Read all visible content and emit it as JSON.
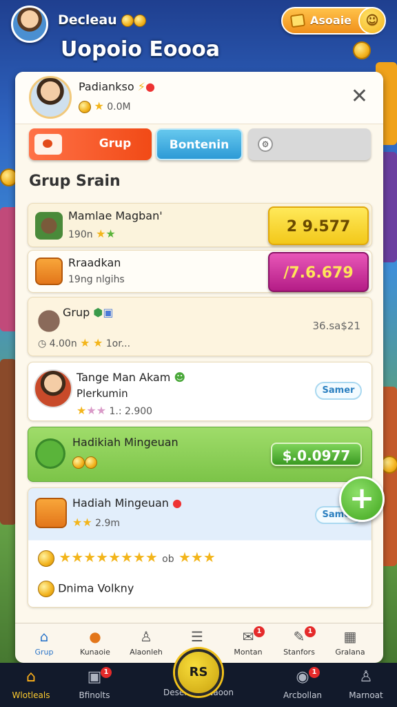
{
  "topbar": {
    "username": "Decleau",
    "title": "Uopoio Eoooa",
    "pill_label": "Asoaie"
  },
  "panel": {
    "profile": {
      "name": "Padiankso",
      "sub": "0.0M"
    },
    "tabs": [
      {
        "label": "Grup"
      },
      {
        "label": "Bontenin"
      },
      {
        "label": ""
      }
    ],
    "section_title": "Grup Srain",
    "rows": [
      {
        "title": "Mamlae Magban'",
        "sub": "190n",
        "value": "2  9.577"
      },
      {
        "title": "Rraadkan",
        "sub": "19ng nlgihs",
        "value": "/7.6.679"
      },
      {
        "title": "Grup",
        "sub": "4.00n",
        "sub2": "1or...",
        "value": "36.sa$21"
      },
      {
        "title": "Tange Man Akam",
        "title2": "Plerkumin",
        "sub": "1.: 2.900",
        "button": "Samer"
      },
      {
        "title": "Hadikiah Mingeuan",
        "value": "$.0.0977"
      },
      {
        "title": "Hadiah Mingeuan",
        "sub": "2.9m",
        "button": "Samer",
        "extra_mark": "ob",
        "footer": "Dnima Volkny"
      }
    ]
  },
  "inner_tabs": [
    {
      "label": "Grup",
      "icon": "home-icon",
      "active": true
    },
    {
      "label": "Kunaoie",
      "icon": "pin-icon"
    },
    {
      "label": "Alaonleh",
      "icon": "person-icon"
    },
    {
      "label": "",
      "icon": "list-icon"
    },
    {
      "label": "Montan",
      "icon": "chat-icon",
      "badge": "1"
    },
    {
      "label": "Stanfors",
      "icon": "megaphone-icon",
      "badge": "1"
    },
    {
      "label": "Gralana",
      "icon": "box-icon"
    }
  ],
  "bottom_nav": [
    {
      "label": "Wlotleals",
      "icon": "home-icon",
      "active": true
    },
    {
      "label": "Bfinolts",
      "icon": "gift-icon",
      "badge": "1"
    },
    {
      "label": "Desenlian Naoon",
      "icon": "rs-coin-icon",
      "center_text": "RS"
    },
    {
      "label": "Arcbollan",
      "icon": "trophy-icon",
      "badge": "1"
    },
    {
      "label": "Marnoat",
      "icon": "person-icon"
    }
  ],
  "colors": {
    "accent_orange": "#f14a16",
    "accent_blue": "#2c9ad6",
    "value_yellow": "#f6d21f",
    "value_magenta": "#c8238f",
    "value_green": "#3faa28"
  }
}
